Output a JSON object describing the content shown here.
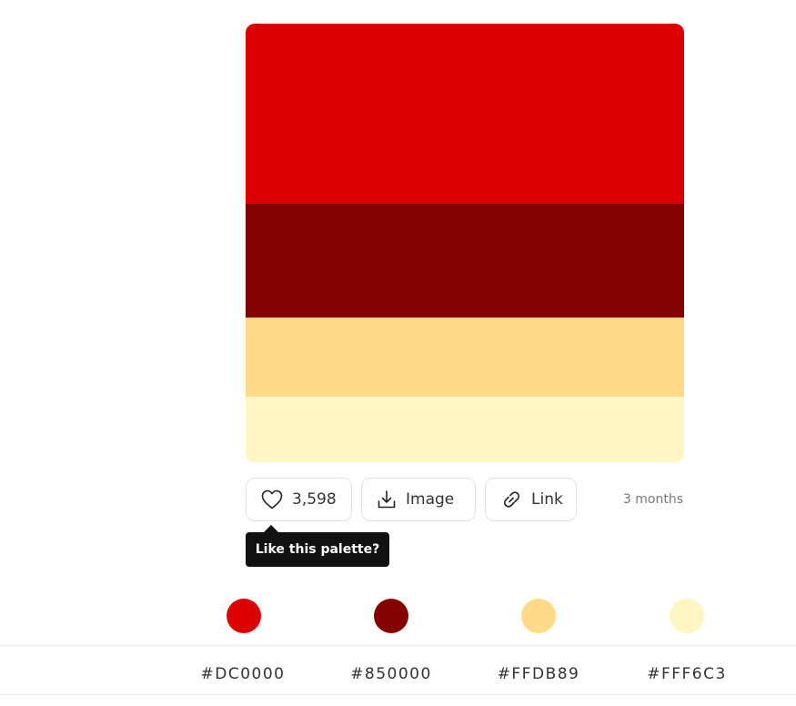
{
  "palette": {
    "colors": [
      "#DC0000",
      "#850000",
      "#FFDB89",
      "#FFF6C3"
    ]
  },
  "actions": {
    "likes": "3,598",
    "image_label": "Image",
    "link_label": "Link"
  },
  "timestamp": "3 months",
  "tooltip": "Like this palette?",
  "hex_codes": [
    "#DC0000",
    "#850000",
    "#FFDB89",
    "#FFF6C3"
  ],
  "icons": {
    "like": "heart-icon",
    "image": "download-icon",
    "link": "link-icon"
  }
}
